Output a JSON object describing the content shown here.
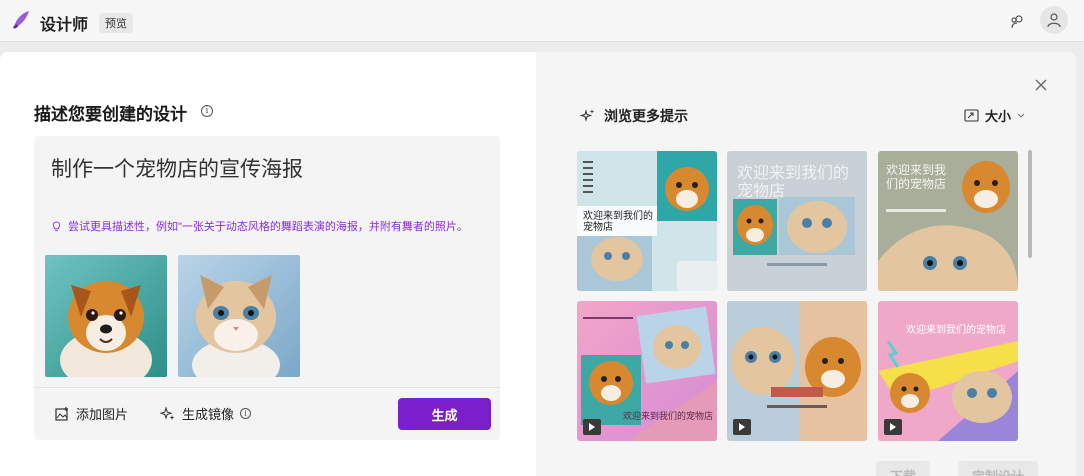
{
  "app": {
    "title": "设计师",
    "badge": "预览"
  },
  "editor": {
    "heading": "描述您要创建的设计",
    "prompt": "制作一个宠物店的宣传海报",
    "hint": "尝试更具描述性，例如\"一张关于动态风格的舞蹈表演的海报，并附有舞者的照片。",
    "add_image": "添加图片",
    "generate_mirror": "生成镜像",
    "generate": "生成"
  },
  "gallery": {
    "browse": "浏览更多提示",
    "size": "大小",
    "templates": [
      {
        "caption": "欢迎来到我们的宠物店"
      },
      {
        "caption": "欢迎来到我们的宠物店"
      },
      {
        "caption": "欢迎来到我们的宠物店"
      },
      {
        "caption": "欢迎来到我们的宠物店"
      },
      {
        "caption": ""
      },
      {
        "caption": "欢迎来到我们的宠物店"
      }
    ]
  },
  "footer": {
    "download": "下载",
    "customize": "定制设计"
  },
  "colors": {
    "accent": "#7a1fc9",
    "hint": "#8a2be2"
  }
}
